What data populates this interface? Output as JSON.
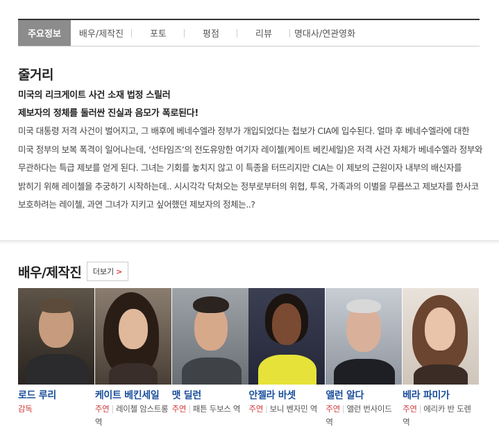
{
  "tabs": [
    {
      "label": "주요정보",
      "active": true
    },
    {
      "label": "배우/제작진",
      "active": false
    },
    {
      "label": "포토",
      "active": false
    },
    {
      "label": "평점",
      "active": false
    },
    {
      "label": "리뷰",
      "active": false
    },
    {
      "label": "명대사/연관영화",
      "active": false
    }
  ],
  "synopsis": {
    "title": "줄거리",
    "subtitle1": "미국의 리크게이트 사건 소재 법정 스릴러",
    "subtitle2": "제보자의 정체를 둘러싼 진실과 음모가 폭로된다!",
    "body": "미국 대통령 저격 사건이 벌어지고, 그 배후에 베네수엘라 정부가 개입되었다는 첩보가 CIA에 입수된다. 얼마 후 베네수엘라에 대한 미국 정부의 보복 폭격이 일어나는데, ‘선타임즈’의 전도유망한 여기자 레이첼(케이트 베킨세일)은 저격 사건 자체가 베네수엘라 정부와 무관하다는 특급 제보를 얻게 된다. 그녀는 기회를 놓치지 않고 이 특종을 터뜨리지만 CIA는 이 제보의 근원이자 내부의 배신자를 밝히기 위해 레이첼을 추궁하기 시작하는데.. 시시각각 닥쳐오는 정부로부터의 위협, 투옥, 가족과의 이별을 무릅쓰고 제보자를 한사코 보호하려는 레이첼, 과연 그녀가 지키고 싶어했던 제보자의 정체는..?"
  },
  "cast": {
    "title": "배우/제작진",
    "more_label": "더보기",
    "more_arrow": ">",
    "members": [
      {
        "name": "로드 루리",
        "type": "감독",
        "role": ""
      },
      {
        "name": "케이트 베킨세일",
        "type": "주연",
        "role": "레이첼 암스트롱 역"
      },
      {
        "name": "맷 딜런",
        "type": "주연",
        "role": "패튼 두보스 역"
      },
      {
        "name": "안젤라 바셋",
        "type": "주연",
        "role": "보니 벤자민 역"
      },
      {
        "name": "앨런 알다",
        "type": "주연",
        "role": "앨런 번사이드 역"
      },
      {
        "name": "베라 파미가",
        "type": "주연",
        "role": "에리카 반 도렌 역"
      }
    ]
  },
  "colors": {
    "active_tab_bg": "#8c8c8c",
    "name_link": "#1a4f9c",
    "role_type": "#d23b3b",
    "more_arrow": "#e53935"
  }
}
